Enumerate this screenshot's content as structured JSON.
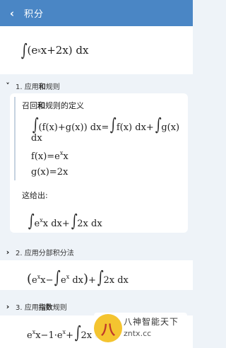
{
  "header": {
    "back_icon": "chevron-left-icon",
    "title": "积分"
  },
  "problem": {
    "int": "∫",
    "pre": "(e",
    "sup": "x",
    "post": "x+2x) dx"
  },
  "steps": [
    {
      "chevron": "˅",
      "label_pre": "1. 应用",
      "label_bold": "和",
      "label_post": "规则"
    },
    {
      "chevron": "›",
      "label_pre": "2. 应用分部积分法",
      "label_bold": "",
      "label_post": ""
    },
    {
      "chevron": "›",
      "label_pre": "3. 应用",
      "label_bold": "指数",
      "label_post": "规则"
    }
  ],
  "step1": {
    "recall_pre": "召回",
    "recall_bold": "和",
    "recall_post": "规则的定义",
    "rule_line1": "(f(x)+g(x)) dx=",
    "rule_f": "f(x) dx+",
    "rule_g": "g(x)",
    "rule_dx": "dx",
    "f_pre": "f(x)=e",
    "f_sup": "x",
    "f_post": "x",
    "g_def": "g(x)=2x",
    "gives": "这给出:",
    "result_a_pre": "e",
    "result_a_sup": "x",
    "result_a_post": "x dx+",
    "result_b": "2x dx"
  },
  "step2": {
    "expr_a": "e",
    "expr_sup": "x",
    "expr_b": "x−",
    "expr_c": "e",
    "expr_c_sup": "x",
    "expr_d": " dx",
    "expr_e": "+",
    "expr_f": "2x dx"
  },
  "step3": {
    "expr_a": "e",
    "expr_sup": "x",
    "expr_b": "x−1·e",
    "expr_c_sup": "x",
    "expr_d": "+",
    "expr_e": "2x dx"
  },
  "watermark": {
    "logo": "八",
    "line1": "八神智能天下",
    "line2": "zntx.cc"
  },
  "colors": {
    "header": "#4a86c5",
    "background": "#eef3f8",
    "card": "#ffffff"
  }
}
